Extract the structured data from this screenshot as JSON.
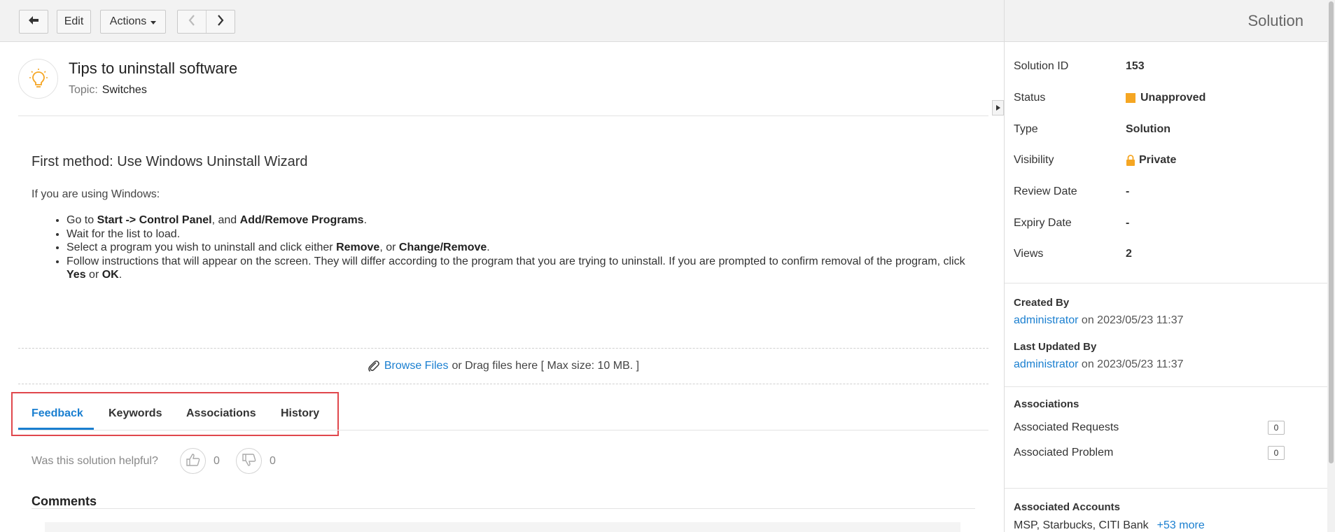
{
  "toolbar": {
    "edit_label": "Edit",
    "actions_label": "Actions"
  },
  "solution": {
    "title": "Tips to uninstall software",
    "topic_label": "Topic:",
    "topic_value": "Switches"
  },
  "article": {
    "heading": "First method: Use Windows Uninstall Wizard",
    "intro": "If you are using Windows:",
    "steps": [
      {
        "a": "Go to ",
        "b1": "Start -> Control Panel",
        "c": ", and ",
        "b2": "Add/Remove Programs",
        "d": "."
      },
      {
        "a": "Wait for the list to load.",
        "b1": "",
        "c": "",
        "b2": "",
        "d": ""
      },
      {
        "a": "Select a program you wish to uninstall and click either ",
        "b1": "Remove",
        "c": ", or ",
        "b2": "Change/Remove",
        "d": "."
      },
      {
        "a": "Follow instructions that will appear on the screen. They will differ according to the program that you are trying to uninstall. If you are prompted to confirm removal of the program, click ",
        "b1": "Yes",
        "c": " or ",
        "b2": "OK",
        "d": "."
      }
    ]
  },
  "upload": {
    "browse_label": "Browse Files",
    "hint": "or Drag files here [ Max size: 10 MB. ]"
  },
  "tabs": [
    "Feedback",
    "Keywords",
    "Associations",
    "History"
  ],
  "feedback": {
    "question": "Was this solution helpful?",
    "likes": "0",
    "dislikes": "0"
  },
  "comments": {
    "heading": "Comments"
  },
  "sidebar": {
    "title": "Solution",
    "props": [
      {
        "label": "Solution ID",
        "value": "153"
      },
      {
        "label": "Status",
        "value": "Unapproved"
      },
      {
        "label": "Type",
        "value": "Solution"
      },
      {
        "label": "Visibility",
        "value": "Private"
      },
      {
        "label": "Review Date",
        "value": "-"
      },
      {
        "label": "Expiry Date",
        "value": "-"
      },
      {
        "label": "Views",
        "value": "2"
      }
    ],
    "created": {
      "heading": "Created By",
      "user": "administrator",
      "on_text": " on 2023/05/23 11:37"
    },
    "updated": {
      "heading": "Last Updated By",
      "user": "administrator",
      "on_text": " on 2023/05/23 11:37"
    },
    "associations": {
      "heading": "Associations",
      "requests_label": "Associated Requests",
      "requests_count": "0",
      "problem_label": "Associated Problem",
      "problem_count": "0"
    },
    "accounts": {
      "heading": "Associated Accounts",
      "list": "MSP, Starbucks, CITI Bank",
      "more": "+53 more"
    }
  },
  "colors": {
    "accent": "#1a7fd0",
    "status": "#f5a623",
    "highlight_box": "#e0474c"
  }
}
